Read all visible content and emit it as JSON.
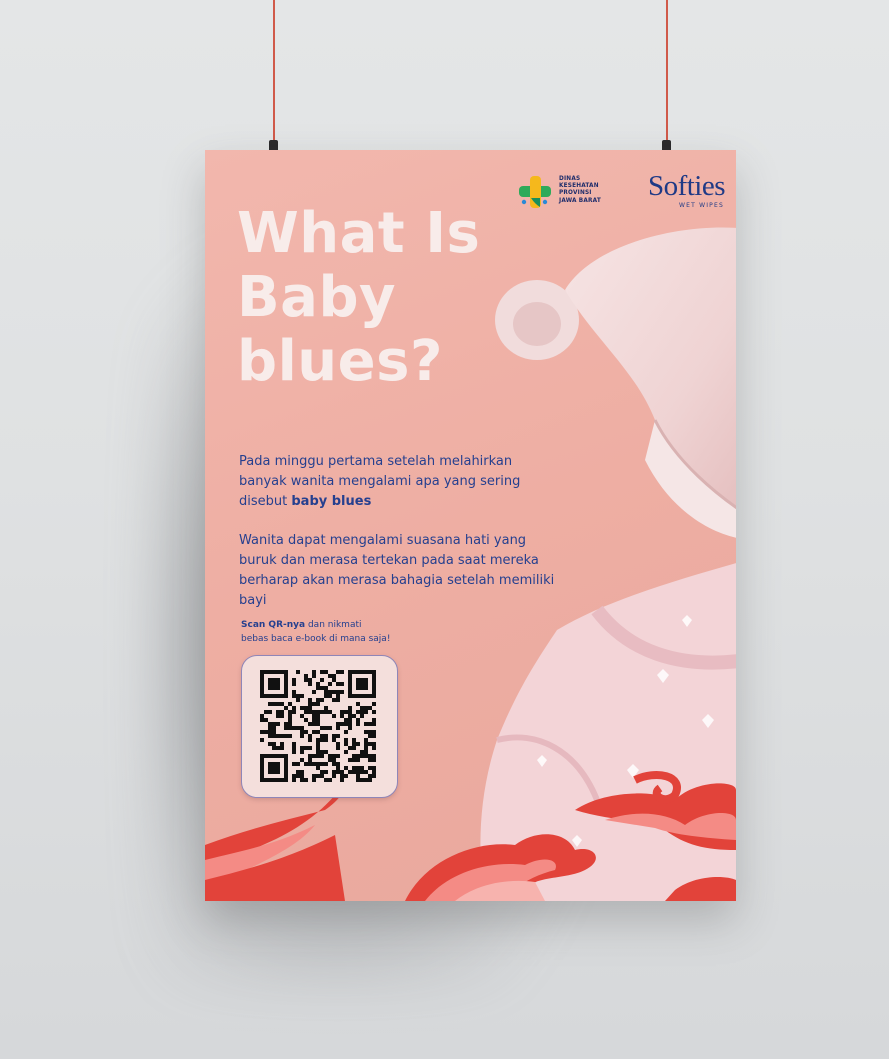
{
  "logos": {
    "dinas_lines": "DINAS\nKESEHATAN\nPROVINSI\nJAWA BARAT",
    "softies_name": "Softies",
    "softies_tagline": "WET WIPES"
  },
  "title": {
    "line1": "What Is",
    "line2": "Baby",
    "line3": "blues?"
  },
  "paragraph1": {
    "lead": "Pada minggu pertama setelah melahirkan banyak wanita mengalami apa yang sering disebut ",
    "emphasis": "baby blues"
  },
  "paragraph2": "Wanita dapat mengalami suasana hati yang buruk dan merasa tertekan pada saat mereka berharap akan merasa bahagia setelah memiliki bayi",
  "scan": {
    "emphasis": "Scan QR-nya",
    "rest_line1": " dan nikmati",
    "line2": "bebas baca e-book di mana saja!"
  },
  "colors": {
    "poster_bg": "#eeaea3",
    "title": "#f8ecea",
    "body_text": "#26408f",
    "brand_blue": "#1f3a86",
    "cloud_red": "#e2433a",
    "cloud_pink": "#f48b85",
    "string": "#d05a4a"
  }
}
